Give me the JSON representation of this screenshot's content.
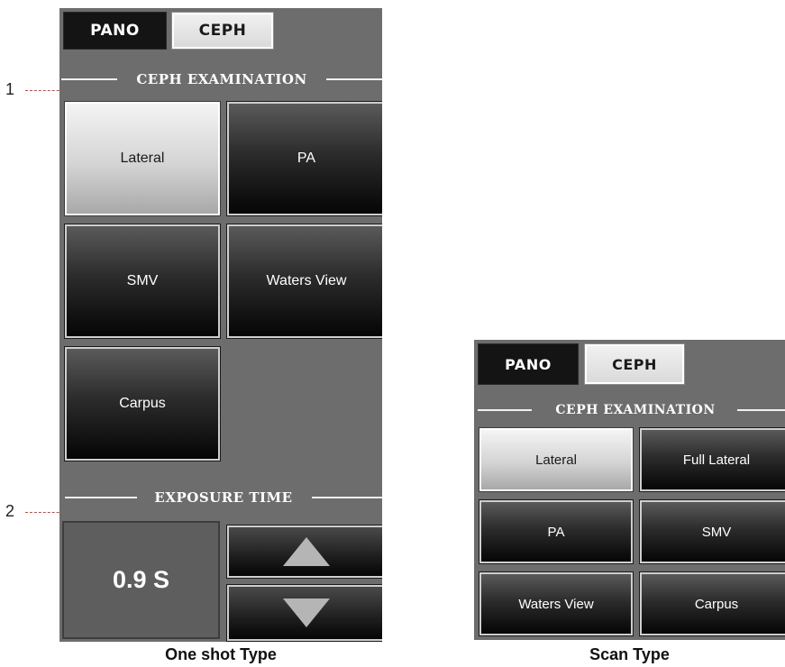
{
  "callouts": [
    "1",
    "2"
  ],
  "one_shot": {
    "tabs": {
      "pano": "PANO",
      "ceph": "CEPH"
    },
    "section_title": "CEPH EXAMINATION",
    "buttons": [
      "Lateral",
      "PA",
      "SMV",
      "Waters View",
      "Carpus"
    ],
    "selected": "Lateral",
    "exposure_title": "EXPOSURE TIME",
    "exposure_value": "0.9 S",
    "caption": "One shot Type"
  },
  "scan": {
    "tabs": {
      "pano": "PANO",
      "ceph": "CEPH"
    },
    "section_title": "CEPH EXAMINATION",
    "buttons": [
      "Lateral",
      "Full Lateral",
      "PA",
      "SMV",
      "Waters View",
      "Carpus"
    ],
    "selected": "Lateral",
    "caption": "Scan Type"
  },
  "colors": {
    "panel": "#6d6d6d",
    "callout": "#e53935"
  },
  "icons": {
    "up": "triangle-up-icon",
    "down": "triangle-down-icon"
  }
}
